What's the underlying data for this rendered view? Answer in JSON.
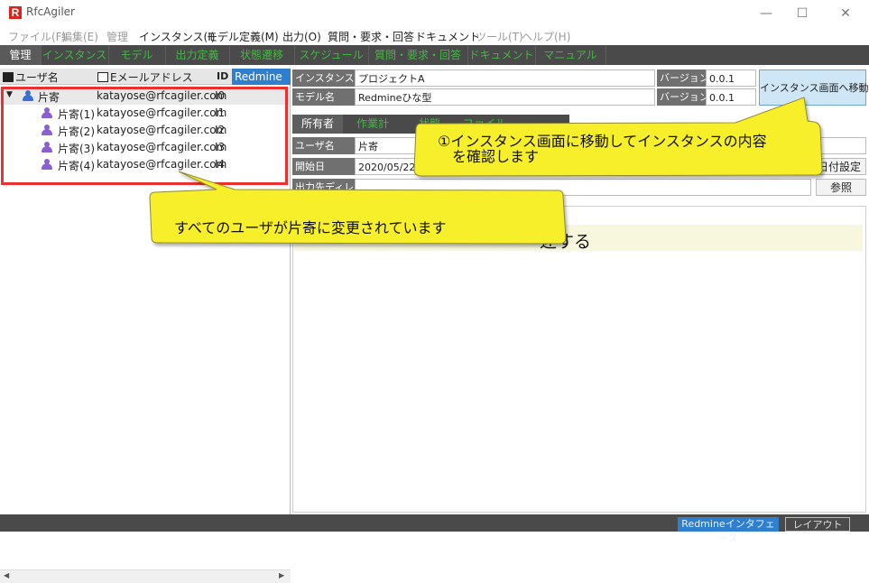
{
  "window": {
    "title": "RfcAgiler",
    "logo_letter": "R",
    "minimize": "—",
    "maximize": "☐",
    "close": "✕"
  },
  "menu": [
    {
      "label": "ファイル(F)",
      "enabled": false
    },
    {
      "label": "編集(E)",
      "enabled": false
    },
    {
      "label": "管理",
      "enabled": false
    },
    {
      "label": "インスタンス(I)",
      "enabled": true
    },
    {
      "label": "モデル定義(M)",
      "enabled": true
    },
    {
      "label": "出力(O)",
      "enabled": true
    },
    {
      "label": "質問・要求・回答",
      "enabled": true
    },
    {
      "label": "ドキュメント",
      "enabled": true
    },
    {
      "label": "ツール(T)",
      "enabled": false
    },
    {
      "label": "ヘルプ(H)",
      "enabled": false
    }
  ],
  "tabs": [
    "管理",
    "インスタンス",
    "モデル",
    "出力定義",
    "状態遷移",
    "スケジュール",
    "質問・要求・回答",
    "ドキュメント",
    "マニュアル"
  ],
  "user_table": {
    "headers": {
      "user": "ユーザ名",
      "email": "Eメールアドレス",
      "id": "ID",
      "redmine": "Redmine"
    },
    "icons": {
      "user": "user-icon",
      "email": "mail-icon",
      "id": "id-icon"
    },
    "expander": "▼",
    "rows": [
      {
        "name": "片寄",
        "email": "katayose@rfcagiler.com",
        "id": "I0"
      },
      {
        "name": "片寄(1)",
        "email": "katayose@rfcagiler.com",
        "id": "I1"
      },
      {
        "name": "片寄(2)",
        "email": "katayose@rfcagiler.com",
        "id": "I2"
      },
      {
        "name": "片寄(3)",
        "email": "katayose@rfcagiler.com",
        "id": "I3"
      },
      {
        "name": "片寄(4)",
        "email": "katayose@rfcagiler.com",
        "id": "I4"
      }
    ],
    "scroll_left": "◀",
    "scroll_right": "▶"
  },
  "instance": {
    "name_label": "インスタンス名",
    "name_value": "プロジェクトA",
    "version_label": "バージョン",
    "version_value": "0.0.1",
    "model_label": "モデル名",
    "model_value": "Redmineひな型",
    "model_version_label": "バージョン",
    "model_version_value": "0.0.1",
    "go_button": "インスタンス画面へ移動"
  },
  "subtabs": [
    "所有者",
    "作業計",
    "状態",
    "ファイル"
  ],
  "owner": {
    "user_label": "ユーザ名",
    "user_value": "片寄",
    "start_label": "開始日",
    "start_value": "2020/05/22",
    "date_button": "日付設定",
    "output_label": "出力先ディレ",
    "browse_button": "参照"
  },
  "description_text": "述する",
  "callouts": {
    "top": "①インスタンス画面に移動してインスタンスの内容\n　を確認します",
    "bottom": "すべてのユーザが片寄に変更されています"
  },
  "bottom": {
    "redmine_button": "Redmineインタフェース",
    "layout_button": "レイアウト"
  },
  "colors": {
    "tab_text": "#3fb93f",
    "accent_blue": "#2f7fcf",
    "highlight_red": "#ee2f2f",
    "callout_yellow": "#f7ef2a"
  }
}
